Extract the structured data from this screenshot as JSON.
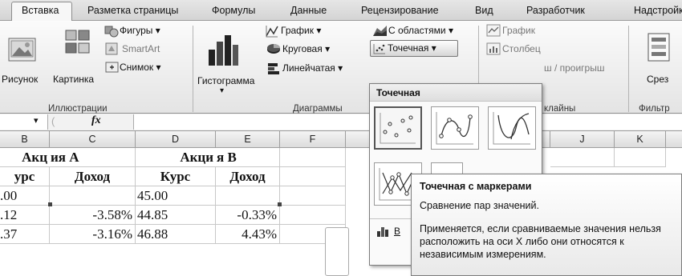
{
  "tabs": [
    "Вставка",
    "Разметка страницы",
    "Формулы",
    "Данные",
    "Рецензирование",
    "Вид",
    "Разработчик",
    "Надстройки"
  ],
  "ribbon": {
    "illustrations": {
      "picture": "Рисунок",
      "clipart": "Картинка",
      "shapes": "Фигуры ▾",
      "smartart": "SmartArt",
      "screenshot": "Снимок ▾",
      "group_label": "Иллюстрации"
    },
    "charts": {
      "histogram": "Гистограмма",
      "histogram_arrow": "▾",
      "line": "График ▾",
      "pie": "Круговая ▾",
      "bar": "Линейчатая ▾",
      "area": "С областями ▾",
      "scatter": "Точечная ▾",
      "group_label": "Диаграммы"
    },
    "sparklines": {
      "line": "График",
      "column": "Столбец",
      "winloss": "ш / проигрыш",
      "group_label": "клайны"
    },
    "filter": {
      "slicer": "Срез",
      "group_label": "Фильтр"
    }
  },
  "formula_bar": {
    "dropdown_arrow": "▾",
    "fx": "fx"
  },
  "grid": {
    "columns": [
      "B",
      "C",
      "D",
      "E",
      "F",
      "J",
      "K"
    ],
    "rows": [
      {
        "b": "Акц",
        "c": "ия А",
        "d": "Акци",
        "e": "я В"
      },
      {
        "b": "урс",
        "c": "Доход",
        "d": "Курс",
        "e": "Доход"
      },
      {
        "b": ".00",
        "c": "",
        "d": "45.00",
        "e": ""
      },
      {
        "b": ".12",
        "c": "-3.58%",
        "d": "44.85",
        "e": "-0.33%"
      },
      {
        "b": ".37",
        "c": "-3.16%",
        "d": "46.88",
        "e": "4.43%"
      }
    ]
  },
  "scatter_menu": {
    "header": "Точечная",
    "other_label": "В"
  },
  "tooltip": {
    "title": "Точечная с маркерами",
    "line1": "Сравнение пар значений.",
    "line2": "Применяется, если сравниваемые значения нельзя расположить на оси X либо они относятся к независимым измерениям."
  }
}
